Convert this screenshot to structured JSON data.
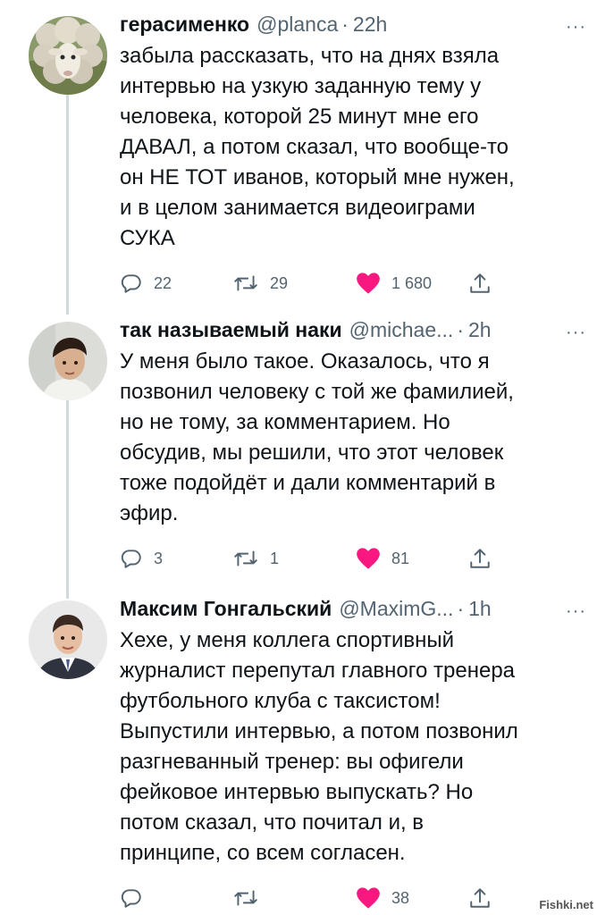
{
  "tweets": [
    {
      "name": "герасименко",
      "handle": "@planca",
      "dot": "·",
      "time": "22h",
      "text": "забыла рассказать, что на днях взяла\nинтервью на узкую заданную тему у\nчеловека, которой 25 минут мне его\nДАВАЛ, а потом сказал, что вообще-то\nон  НЕ ТОТ иванов, который мне нужен,\nи в целом занимается видеоиграми\nСУКА",
      "replies": "22",
      "retweets": "29",
      "likes": "1 680",
      "liked": true
    },
    {
      "name": "так называемый наки",
      "handle": "@michae...",
      "dot": "·",
      "time": "2h",
      "text": "У меня было такое. Оказалось, что я\nпозвонил человеку с той же фамилией,\nно не тому, за комментарием. Но\nобсудив, мы решили, что этот человек\nтоже подойдёт и дали комментарий в\nэфир.",
      "replies": "3",
      "retweets": "1",
      "likes": "81",
      "liked": true
    },
    {
      "name": "Максим Гонгальский",
      "handle": "@MaximG...",
      "dot": "·",
      "time": "1h",
      "text": "Хехе, у меня коллега спортивный\nжурналист перепутал главного тренера\nфутбольного клуба с таксистом!\nВыпустили интервью, а потом позвонил\nразгневанный тренер: вы офигели\nфейковое интервью выпускать? Но\nпотом сказал, что почитал и, в\nпринципе, со всем согласен.",
      "replies": "",
      "retweets": "",
      "likes": "38",
      "liked": true
    }
  ],
  "more_glyph": "···",
  "watermark": "Fishki.net",
  "colors": {
    "like": "#f91880",
    "muted": "#536471",
    "thread": "#cfd9de"
  }
}
